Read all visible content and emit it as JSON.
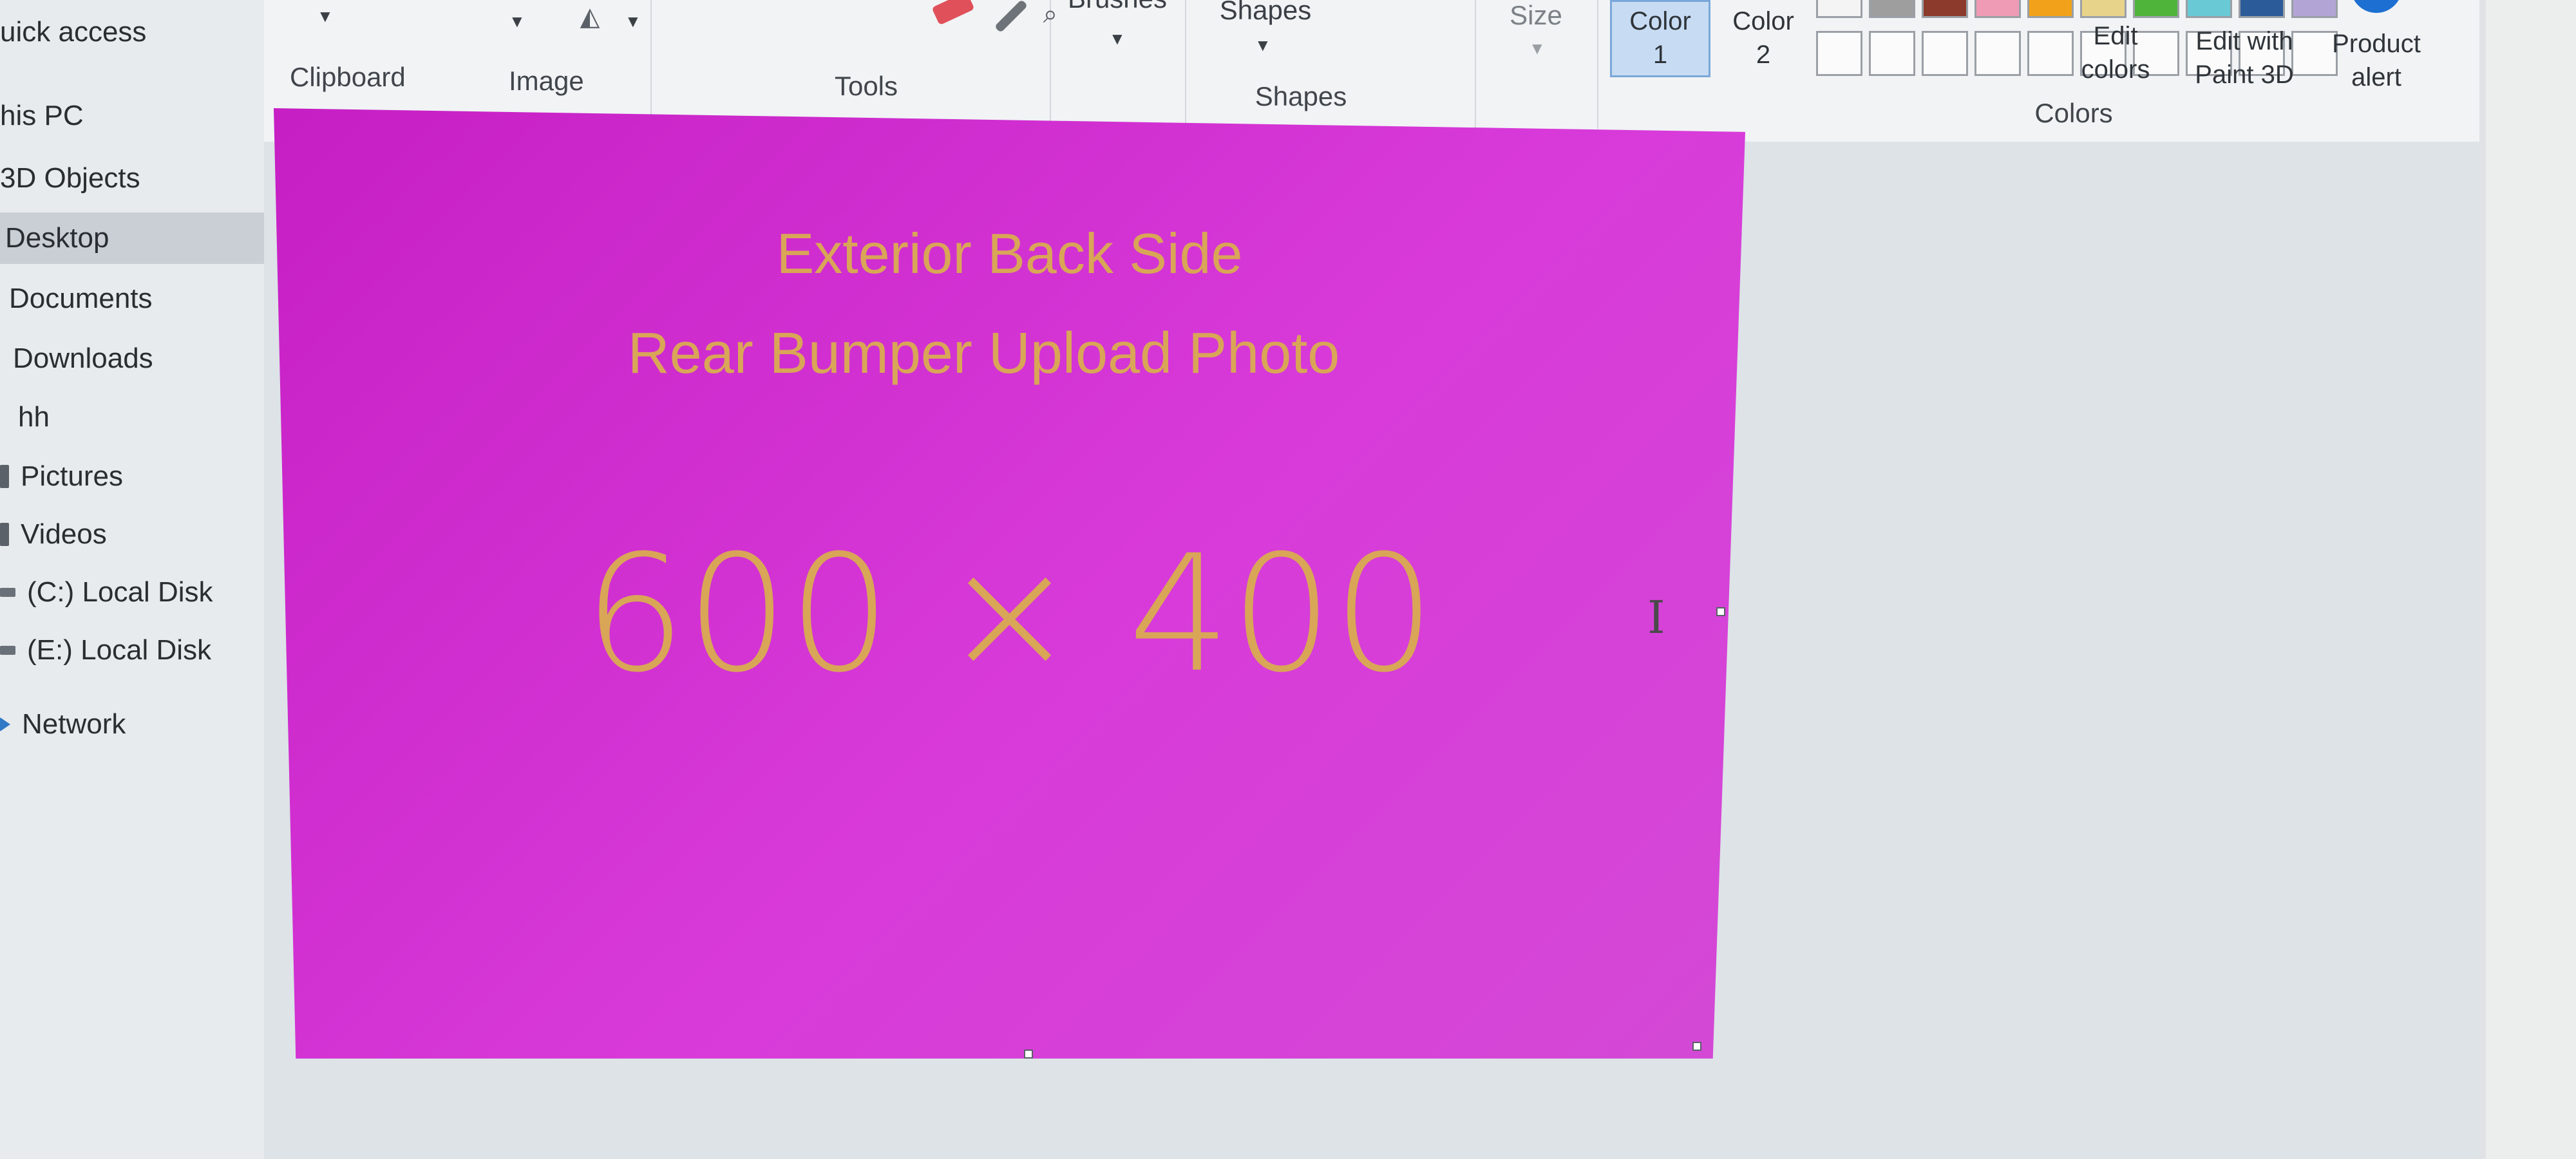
{
  "nav": {
    "items": [
      {
        "label": "uick access"
      },
      {
        "label": "his PC"
      },
      {
        "label": "3D Objects"
      },
      {
        "label": "Desktop"
      },
      {
        "label": "Documents"
      },
      {
        "label": "Downloads"
      },
      {
        "label": "hh"
      },
      {
        "label": "Pictures"
      },
      {
        "label": "Videos"
      },
      {
        "label": "(C:) Local Disk"
      },
      {
        "label": "(E:) Local Disk"
      },
      {
        "label": "Network"
      }
    ]
  },
  "ribbon": {
    "groups": {
      "clipboard": "Clipboard",
      "image": "Image",
      "tools": "Tools",
      "brushes": "Brushes",
      "shapes_button": "Shapes",
      "shapes": "Shapes",
      "size": "Size",
      "colors": "Colors"
    },
    "color1_line1": "Color",
    "color1_line2": "1",
    "color2_line1": "Color",
    "color2_line2": "2",
    "edit_colors_line1": "Edit",
    "edit_colors_line2": "colors",
    "paint3d_line1": "Edit with",
    "paint3d_line2": "Paint 3D",
    "product_alert_line1": "Product",
    "product_alert_line2": "alert",
    "palette_colors": [
      "#f4f4f4",
      "#9e9e9e",
      "#8b3a2b",
      "#ef9bb6",
      "#f2a21a",
      "#e7d48a",
      "#4fb43a",
      "#69c9d4",
      "#2b5b99",
      "#b3a4d6"
    ]
  },
  "canvas": {
    "image_title": "Exterior Back Side",
    "image_subtitle": "Rear Bumper Upload Photo",
    "image_dimensions": "600 × 400",
    "background_color": "#d33fd3",
    "text_color": "#d9a557"
  }
}
